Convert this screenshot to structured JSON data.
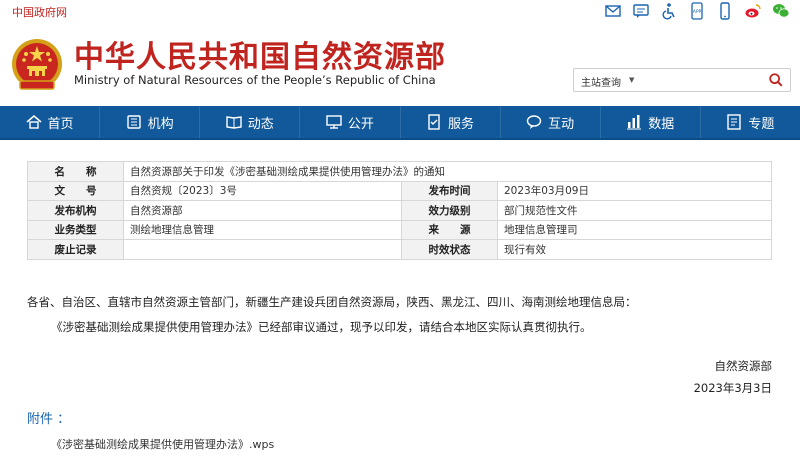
{
  "topbar": {
    "gov_link": "中国政府网",
    "icons": [
      "mail-icon",
      "message-icon",
      "accessibility-icon",
      "app-icon",
      "mobile-icon",
      "weibo-icon",
      "wechat-icon"
    ],
    "app_text": "APP"
  },
  "header": {
    "title_cn": "中华人民共和国自然资源部",
    "title_en": "Ministry of Natural Resources of the People’s Republic of China"
  },
  "search": {
    "scope": "主站查询"
  },
  "nav": [
    {
      "label": "首页",
      "icon": "home-icon"
    },
    {
      "label": "机构",
      "icon": "organization-icon"
    },
    {
      "label": "动态",
      "icon": "news-icon"
    },
    {
      "label": "公开",
      "icon": "disclosure-icon"
    },
    {
      "label": "服务",
      "icon": "service-icon"
    },
    {
      "label": "互动",
      "icon": "interaction-icon"
    },
    {
      "label": "数据",
      "icon": "data-icon"
    },
    {
      "label": "专题",
      "icon": "topic-icon"
    }
  ],
  "info": {
    "name_label": "名　　称",
    "name_value": "自然资源部关于印发《涉密基础测绘成果提供使用管理办法》的通知",
    "doc_no_label": "文　　号",
    "doc_no_value": "自然资规〔2023〕3号",
    "pub_time_label": "发布时间",
    "pub_time_value": "2023年03月09日",
    "publisher_label": "发布机构",
    "publisher_value": "自然资源部",
    "validity_label": "效力级别",
    "validity_value": "部门规范性文件",
    "biz_type_label": "业务类型",
    "biz_type_value": "测绘地理信息管理",
    "source_label": "来　　源",
    "source_value": "地理信息管理司",
    "repeal_label": "废止记录",
    "repeal_value": "",
    "status_label": "时效状态",
    "status_value": "现行有效"
  },
  "body": {
    "addressee": "各省、自治区、直辖市自然资源主管部门，新疆生产建设兵团自然资源局，陕西、黑龙江、四川、海南测绘地理信息局：",
    "paragraph": "《涉密基础测绘成果提供使用管理办法》已经部审议通过，现予以印发，请结合本地区实际认真贯彻执行。",
    "signature": "自然资源部",
    "date": "2023年3月3日"
  },
  "attachment": {
    "label": "附件 ：",
    "file": "《涉密基础测绘成果提供使用管理办法》.wps"
  },
  "colors": {
    "brand_red": "#c0241f",
    "nav_blue": "#11599a",
    "link_blue": "#1a64b0"
  }
}
